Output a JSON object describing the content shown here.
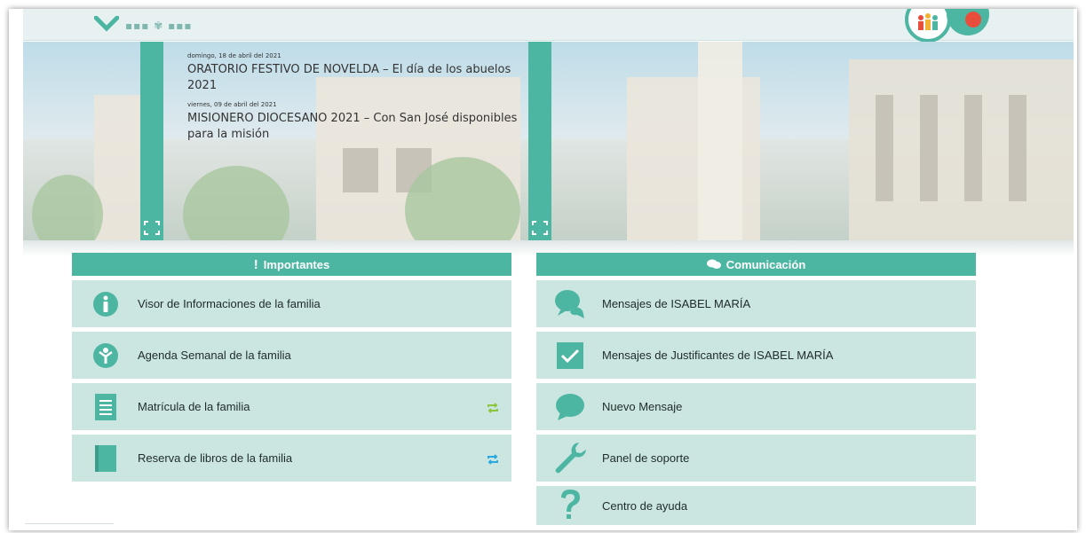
{
  "colors": {
    "accent": "#4db6a2",
    "item_bg": "#cbe6e1",
    "text": "#1e2b2a"
  },
  "banner": {
    "news": [
      {
        "date": "domingo, 18 de abril del 2021",
        "title": "ORATORIO FESTIVO DE NOVELDA – El día de los abuelos 2021"
      },
      {
        "date": "viernes, 09 de abril del 2021",
        "title": "MISIONERO DIOCESANO 2021 – Con San José disponibles para la misión"
      }
    ]
  },
  "importantes": {
    "header": "Importantes",
    "header_icon": "exclamation-icon",
    "items": [
      {
        "label": "Visor de Informaciones de la familia",
        "icon": "info-icon"
      },
      {
        "label": "Agenda Semanal de la familia",
        "icon": "agenda-icon"
      },
      {
        "label": "Matrícula de la familia",
        "icon": "document-icon",
        "action_icon": "refresh-icon",
        "action_color": "#8cc63f"
      },
      {
        "label": "Reserva de libros de la familia",
        "icon": "book-icon",
        "action_icon": "refresh-icon",
        "action_color": "#29a9e0"
      }
    ]
  },
  "comunicacion": {
    "header": "Comunicación",
    "header_icon": "chat-icon",
    "items": [
      {
        "label": "Mensajes de ISABEL MARÍA",
        "icon": "messages-icon"
      },
      {
        "label": "Mensajes de Justificantes de ISABEL MARÍA",
        "icon": "checkbox-icon"
      },
      {
        "label": "Nuevo Mensaje",
        "icon": "speech-bubble-icon"
      },
      {
        "label": "Panel de soporte",
        "icon": "wrench-icon"
      },
      {
        "label": "Centro de ayuda",
        "icon": "question-icon"
      }
    ]
  }
}
